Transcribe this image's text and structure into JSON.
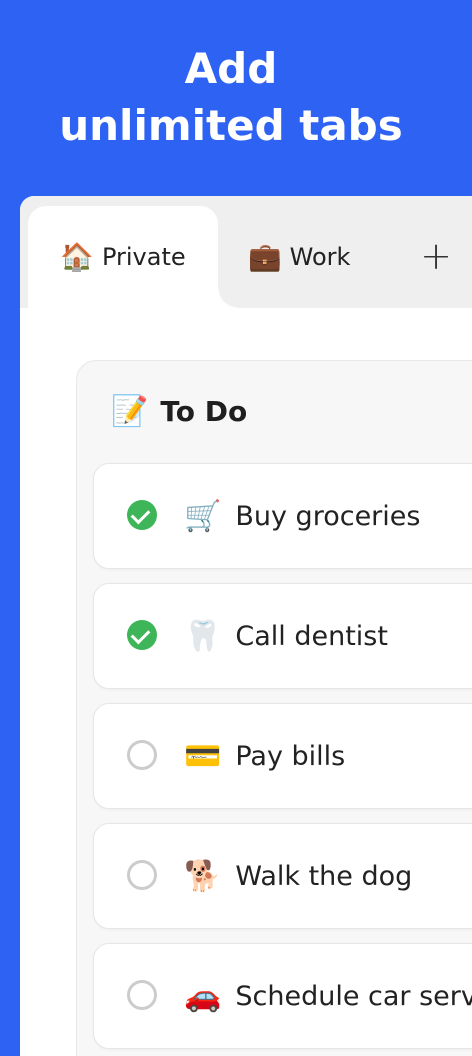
{
  "headline": {
    "line1": "Add",
    "line2": "unlimited tabs"
  },
  "tabs": [
    {
      "emoji": "🏠",
      "label": "Private",
      "active": true
    },
    {
      "emoji": "💼",
      "label": "Work",
      "active": false
    }
  ],
  "add_tab_symbol": "+",
  "list": {
    "emoji": "📝",
    "title": "To Do",
    "items": [
      {
        "emoji": "🛒",
        "label": "Buy groceries",
        "done": true
      },
      {
        "emoji": "🦷",
        "label": "Call dentist",
        "done": true
      },
      {
        "emoji": "💳",
        "label": "Pay bills",
        "done": false
      },
      {
        "emoji": "🐕",
        "label": "Walk the dog",
        "done": false
      },
      {
        "emoji": "🚗",
        "label": "Schedule car serv",
        "done": false
      }
    ]
  },
  "colors": {
    "background": "#2d62f2",
    "check_done": "#3fb559",
    "check_open_border": "#cccccc"
  }
}
